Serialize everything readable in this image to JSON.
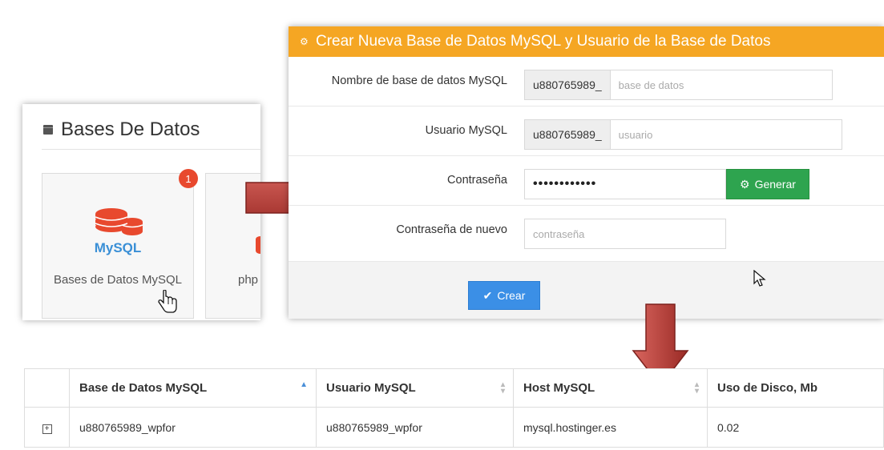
{
  "left_card": {
    "title": "Bases De Datos",
    "tiles": [
      {
        "label": "Bases de Datos MySQL",
        "logo_text": "MySQL",
        "badge": "1"
      },
      {
        "label": "php"
      }
    ]
  },
  "form": {
    "title": "Crear Nueva Base de Datos MySQL y Usuario de la Base de Datos",
    "fields": [
      {
        "label": "Nombre de base de datos MySQL",
        "prefix": "u880765989_",
        "placeholder": "base de datos"
      },
      {
        "label": "Usuario MySQL",
        "prefix": "u880765989_",
        "placeholder": "usuario"
      },
      {
        "label": "Contraseña",
        "value": "••••••••••••",
        "button": "Generar"
      },
      {
        "label": "Contraseña de nuevo",
        "placeholder": "contraseña"
      }
    ],
    "submit_label": "Crear"
  },
  "table": {
    "columns": [
      "Base de Datos MySQL",
      "Usuario MySQL",
      "Host MySQL",
      "Uso de Disco, Mb"
    ],
    "rows": [
      {
        "db": "u880765989_wpfor",
        "user": "u880765989_wpfor",
        "host": "mysql.hostinger.es",
        "disk": "0.02"
      }
    ]
  },
  "colors": {
    "header_orange": "#f5a623",
    "generate_green": "#2ea44f",
    "create_blue": "#3b8fe6",
    "badge_red": "#e8492e",
    "mysql_red": "#e8492e",
    "arrow_red": "#b0302a"
  },
  "icons": {
    "section": "database-square-icon",
    "header": "cogs-icon",
    "generate": "gear-icon",
    "create": "check-icon",
    "expand": "plus-square-icon"
  }
}
